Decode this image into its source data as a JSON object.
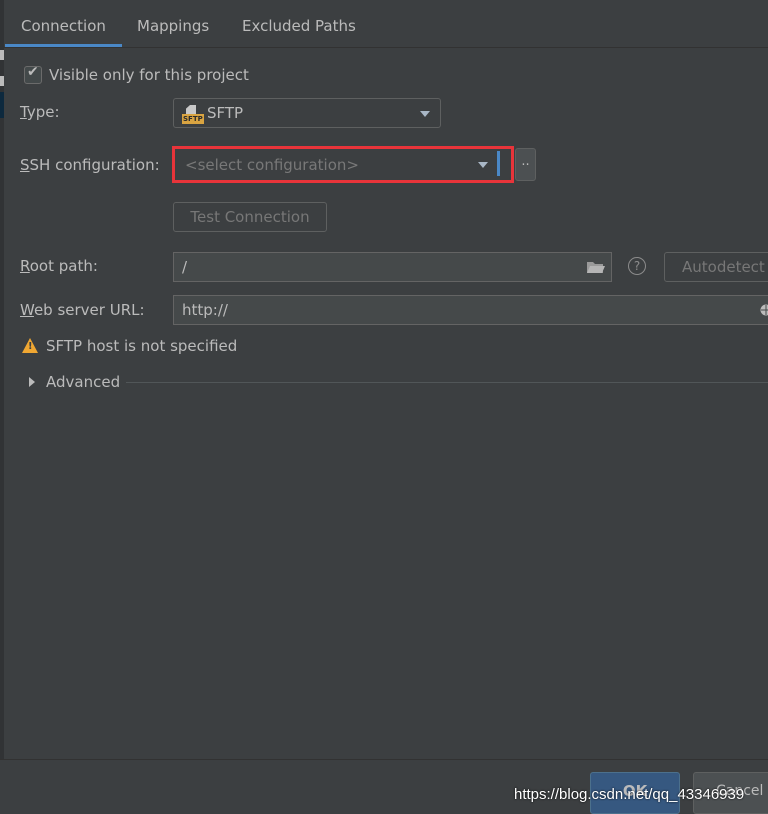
{
  "tabs": [
    {
      "label": "Connection",
      "active": true
    },
    {
      "label": "Mappings",
      "active": false
    },
    {
      "label": "Excluded Paths",
      "active": false
    }
  ],
  "visible_only": {
    "label": "Visible only for this project",
    "checked": true
  },
  "type": {
    "label_prefix": "",
    "label_mnemonic": "T",
    "label_rest": "ype:",
    "value": "SFTP",
    "icon": "sftp-icon",
    "icon_text": "SFTP"
  },
  "ssh": {
    "label_mnemonic": "S",
    "label_rest": "SH configuration:",
    "placeholder": "<select configuration>",
    "more_label": ".."
  },
  "test_connection": {
    "label": "Test Connection"
  },
  "root_path": {
    "label_mnemonic": "R",
    "label_rest": "oot path:",
    "value": "/",
    "help_label": "?",
    "autodetect_label": "Autodetect"
  },
  "web_server": {
    "label_mnemonic": "W",
    "label_rest": "eb server URL:",
    "value": "http://"
  },
  "warning": {
    "text": "SFTP host is not specified",
    "icon": "warning-icon"
  },
  "advanced": {
    "label": "Advanced"
  },
  "footer": {
    "ok_label": "OK",
    "cancel_label": "Cancel"
  },
  "watermark": "https://blog.csdn.net/qq_43346939",
  "colors": {
    "accent": "#4a88c7",
    "highlight": "#e8343a",
    "warning": "#f0a732",
    "background": "#3c3f41"
  }
}
